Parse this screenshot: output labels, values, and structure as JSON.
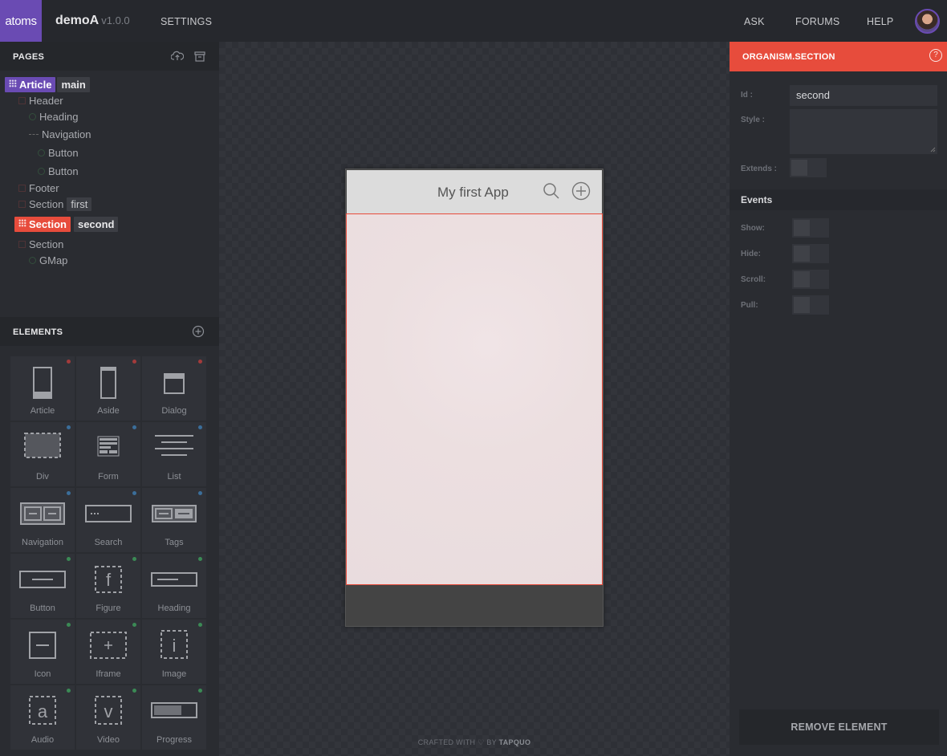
{
  "topbar": {
    "logo": "atoms",
    "app_name": "demoA",
    "version": "v1.0.0",
    "settings": "SETTINGS",
    "ask": "ASK",
    "forums": "FORUMS",
    "help": "HELP"
  },
  "pages": {
    "title": "PAGES",
    "tree": [
      {
        "label": "Article",
        "tag": "main"
      },
      {
        "label": "Header"
      },
      {
        "label": "Heading"
      },
      {
        "label": "Navigation"
      },
      {
        "label": "Button"
      },
      {
        "label": "Button"
      },
      {
        "label": "Footer"
      },
      {
        "label": "Section",
        "tag": "first"
      },
      {
        "label": "Section",
        "tag": "second"
      },
      {
        "label": "Section"
      },
      {
        "label": "GMap"
      }
    ]
  },
  "elements": {
    "title": "ELEMENTS",
    "items": [
      {
        "label": "Article",
        "icon": "article-icon",
        "dot": "#a33b3b"
      },
      {
        "label": "Aside",
        "icon": "aside-icon",
        "dot": "#a33b3b"
      },
      {
        "label": "Dialog",
        "icon": "dialog-icon",
        "dot": "#a33b3b"
      },
      {
        "label": "Div",
        "icon": "div-icon",
        "dot": "#3b6e9a"
      },
      {
        "label": "Form",
        "icon": "form-icon",
        "dot": "#3b6e9a"
      },
      {
        "label": "List",
        "icon": "list-icon",
        "dot": "#3b6e9a"
      },
      {
        "label": "Navigation",
        "icon": "navigation-icon",
        "dot": "#3b6e9a"
      },
      {
        "label": "Search",
        "icon": "search-field-icon",
        "dot": "#3b6e9a"
      },
      {
        "label": "Tags",
        "icon": "tags-icon",
        "dot": "#3b6e9a"
      },
      {
        "label": "Button",
        "icon": "button-icon",
        "dot": "#3b8a55"
      },
      {
        "label": "Figure",
        "icon": "figure-icon",
        "dot": "#3b8a55"
      },
      {
        "label": "Heading",
        "icon": "heading-icon",
        "dot": "#3b8a55"
      },
      {
        "label": "Icon",
        "icon": "icon-element-icon",
        "dot": "#3b8a55"
      },
      {
        "label": "Iframe",
        "icon": "iframe-icon",
        "dot": "#3b8a55"
      },
      {
        "label": "Image",
        "icon": "image-icon",
        "dot": "#3b8a55"
      },
      {
        "label": "Audio",
        "icon": "audio-icon",
        "dot": "#3b8a55"
      },
      {
        "label": "Video",
        "icon": "video-icon",
        "dot": "#3b8a55"
      },
      {
        "label": "Progress",
        "icon": "progress-icon",
        "dot": "#3b8a55"
      }
    ]
  },
  "canvas": {
    "app_title": "My first App",
    "credits_prefix": "CRAFTED WITH",
    "credits_by": "BY",
    "credits_brand": "TAPQUO"
  },
  "inspector": {
    "title": "ORGANISM.SECTION",
    "id_label": "Id :",
    "id_value": "second",
    "style_label": "Style :",
    "style_value": "",
    "extends_label": "Extends :",
    "events_title": "Events",
    "show_label": "Show:",
    "hide_label": "Hide:",
    "scroll_label": "Scroll:",
    "pull_label": "Pull:",
    "remove_label": "REMOVE ELEMENT"
  },
  "colors": {
    "accent": "#e74c3c",
    "brand": "#6a4bb3"
  }
}
